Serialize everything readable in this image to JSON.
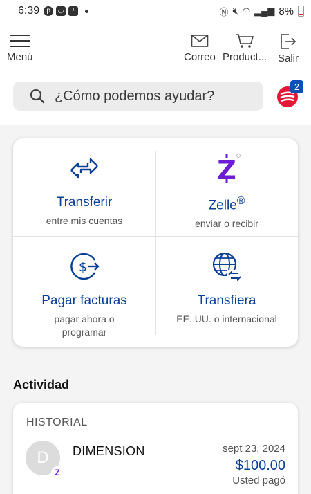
{
  "status_bar": {
    "time": "6:39",
    "battery": "8%"
  },
  "header": {
    "menu_label": "Menú",
    "nav": [
      {
        "label": "Correo",
        "icon": "mail-icon"
      },
      {
        "label": "Product...",
        "icon": "cart-icon"
      },
      {
        "label": "Salir",
        "icon": "logout-icon"
      }
    ],
    "search_placeholder": "¿Cómo podemos ayudar?",
    "notifications_count": "2"
  },
  "quick_actions": [
    {
      "title": "Transferir",
      "subtitle": "entre mis cuentas",
      "icon": "transfer-arrows-icon"
    },
    {
      "title": "Zelle",
      "title_sup": "®",
      "subtitle": "enviar o recibir",
      "icon": "zelle-icon"
    },
    {
      "title": "Pagar facturas",
      "subtitle": "pagar ahora o programar",
      "icon": "pay-bills-icon"
    },
    {
      "title": "Transfiera",
      "subtitle": "EE. UU. o internacional",
      "icon": "globe-transfer-icon"
    }
  ],
  "activity": {
    "section_title": "Actividad",
    "card_title": "HISTORIAL",
    "items": [
      {
        "avatar_letter": "D",
        "merchant": "DIMENSION",
        "date": "sept 23, 2024",
        "amount": "$100.00",
        "status": "Usted pagó"
      }
    ]
  },
  "colors": {
    "primary_blue": "#0a3f96",
    "zelle_purple": "#6d1ed4",
    "badge_blue": "#0b4fb7",
    "erica_red": "#e31837"
  }
}
